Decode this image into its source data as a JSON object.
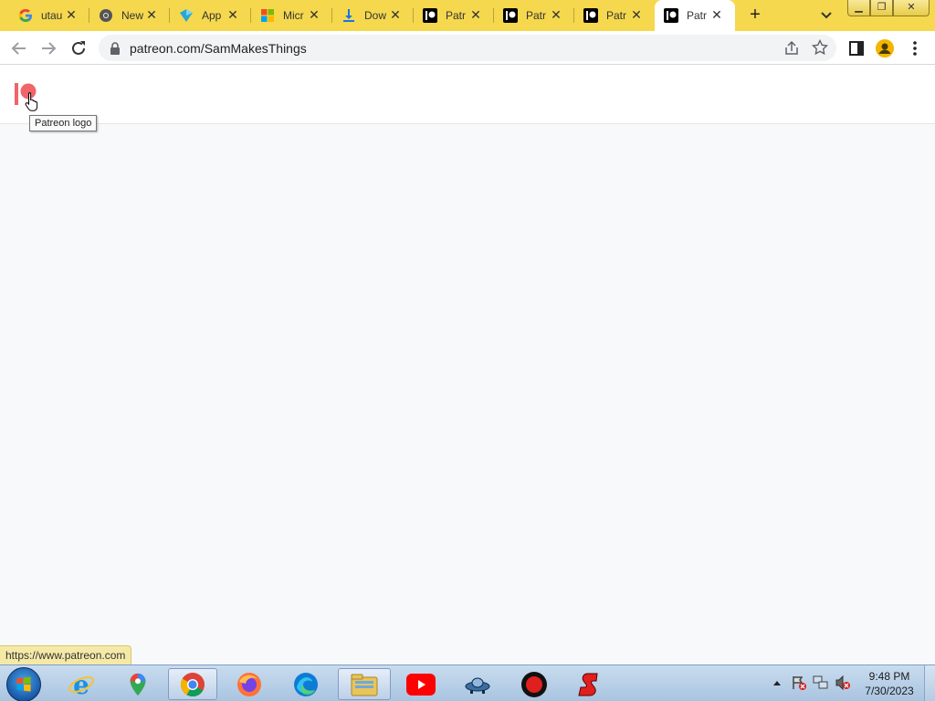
{
  "browser": {
    "tabs": [
      {
        "title": "utau",
        "favicon": "google-icon"
      },
      {
        "title": "New",
        "favicon": "chrome-icon"
      },
      {
        "title": "App",
        "favicon": "app-icon"
      },
      {
        "title": "Micr",
        "favicon": "microsoft-icon"
      },
      {
        "title": "Dow",
        "favicon": "download-icon"
      },
      {
        "title": "Patr",
        "favicon": "patreon-icon"
      },
      {
        "title": "Patr",
        "favicon": "patreon-icon"
      },
      {
        "title": "Patr",
        "favicon": "patreon-icon"
      },
      {
        "title": "Patr",
        "favicon": "patreon-icon",
        "active": true
      }
    ],
    "address": "patreon.com/SamMakesThings",
    "accent_color": "#f5d84e"
  },
  "page": {
    "logo_tooltip": "Patreon logo",
    "status_url": "https://www.patreon.com",
    "brand_color": "#f0646a"
  },
  "taskbar": {
    "apps": [
      "internet-explorer-icon",
      "google-maps-icon",
      "chrome-icon",
      "firefox-icon",
      "edge-icon",
      "file-explorer-icon",
      "youtube-icon",
      "ufo-app-icon",
      "record-icon",
      "s-app-icon"
    ],
    "time": "9:48 PM",
    "date": "7/30/2023"
  }
}
